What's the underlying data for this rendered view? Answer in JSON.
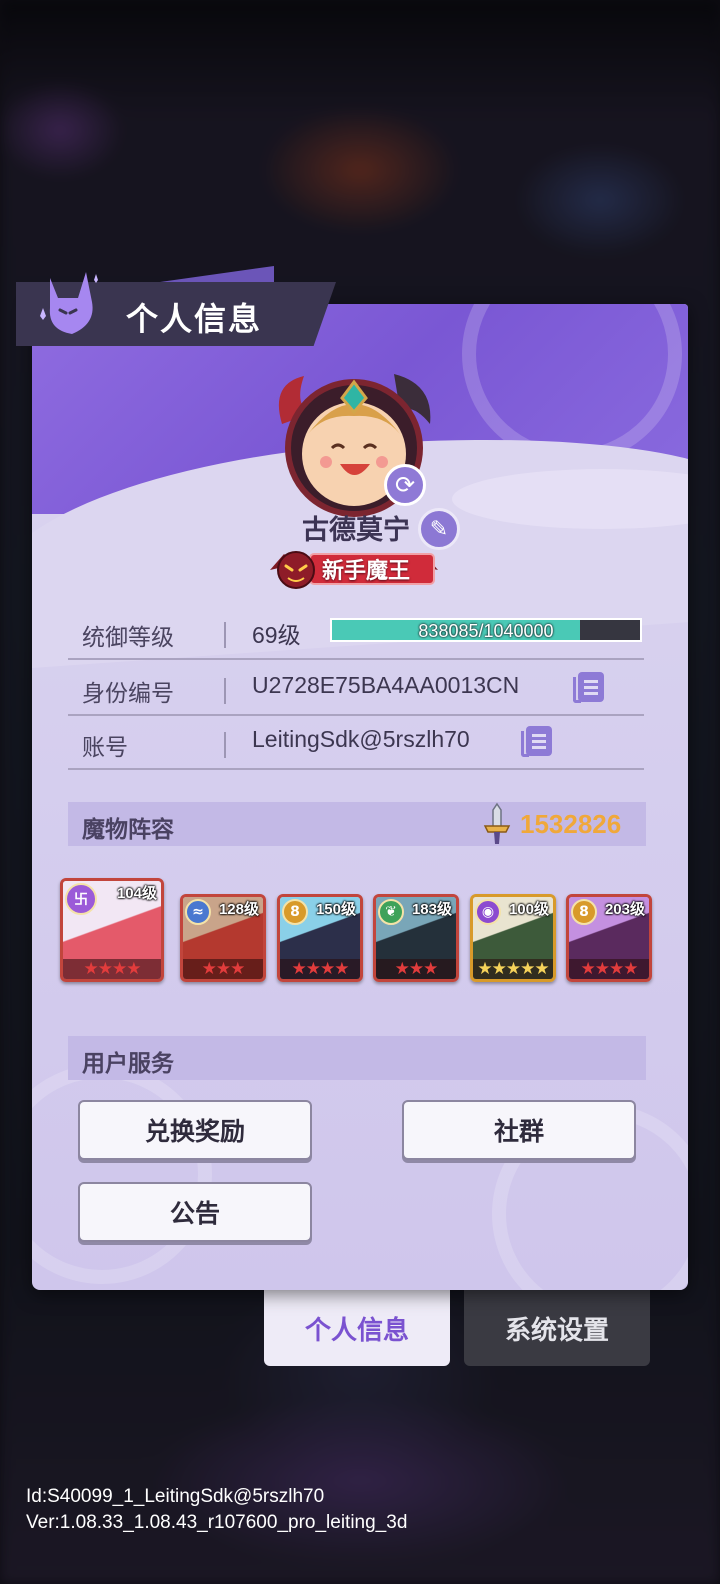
{
  "header": {
    "title": "个人信息"
  },
  "profile": {
    "nickname": "古德莫宁",
    "title_badge": "新手魔王"
  },
  "info": {
    "level_label": "统御等级",
    "level_value": "69级",
    "exp_text": "838085/1040000",
    "exp_current": 838085,
    "exp_max": 1040000,
    "id_label": "身份编号",
    "id_value": "U2728E75BA4AA0013CN",
    "account_label": "账号",
    "account_value": "LeitingSdk@5rszlh70"
  },
  "lineup": {
    "label": "魔物阵容",
    "power": "1532826",
    "monsters": [
      {
        "level": "104级",
        "stars": "★★★★",
        "element": "fire",
        "rarity": "red"
      },
      {
        "level": "128级",
        "stars": "★★★",
        "element": "water",
        "rarity": "red"
      },
      {
        "level": "150级",
        "stars": "★★★★",
        "element": "light",
        "rarity": "red"
      },
      {
        "level": "183级",
        "stars": "★★★",
        "element": "wood",
        "rarity": "red"
      },
      {
        "level": "100级",
        "stars": "★★★★★",
        "element": "dark",
        "rarity": "gold"
      },
      {
        "level": "203级",
        "stars": "★★★★",
        "element": "light",
        "rarity": "red"
      }
    ]
  },
  "services": {
    "label": "用户服务",
    "redeem": "兑换奖励",
    "community": "社群",
    "notice": "公告"
  },
  "tabs": {
    "info": "个人信息",
    "settings": "系统设置"
  },
  "footer": {
    "id_line": "Id:S40099_1_LeitingSdk@5rszlh70",
    "ver_line": "Ver:1.08.33_1.08.43_r107600_pro_leiting_3d"
  },
  "colors": {
    "accent": "#7a57d4",
    "power": "#f0a83a",
    "exp_fill": "#4ac9b6"
  }
}
